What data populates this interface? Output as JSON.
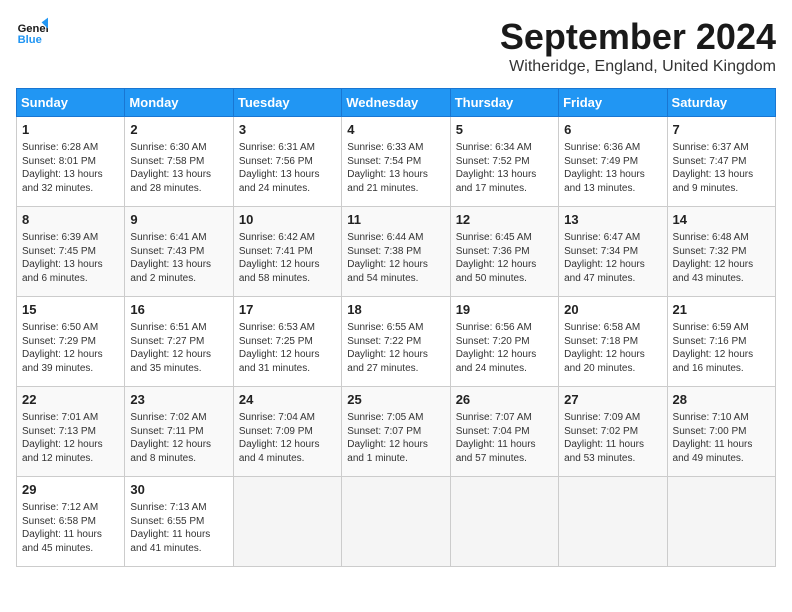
{
  "header": {
    "logo_line1": "General",
    "logo_line2": "Blue",
    "title": "September 2024",
    "subtitle": "Witheridge, England, United Kingdom"
  },
  "calendar": {
    "days_of_week": [
      "Sunday",
      "Monday",
      "Tuesday",
      "Wednesday",
      "Thursday",
      "Friday",
      "Saturday"
    ],
    "weeks": [
      [
        {
          "day": "",
          "empty": true
        },
        {
          "day": "",
          "empty": true
        },
        {
          "day": "",
          "empty": true
        },
        {
          "day": "",
          "empty": true
        },
        {
          "day": "",
          "empty": true
        },
        {
          "day": "",
          "empty": true
        },
        {
          "day": "",
          "empty": true
        }
      ],
      [
        {
          "day": "1",
          "info": "Sunrise: 6:28 AM\nSunset: 8:01 PM\nDaylight: 13 hours\nand 32 minutes."
        },
        {
          "day": "2",
          "info": "Sunrise: 6:30 AM\nSunset: 7:58 PM\nDaylight: 13 hours\nand 28 minutes."
        },
        {
          "day": "3",
          "info": "Sunrise: 6:31 AM\nSunset: 7:56 PM\nDaylight: 13 hours\nand 24 minutes."
        },
        {
          "day": "4",
          "info": "Sunrise: 6:33 AM\nSunset: 7:54 PM\nDaylight: 13 hours\nand 21 minutes."
        },
        {
          "day": "5",
          "info": "Sunrise: 6:34 AM\nSunset: 7:52 PM\nDaylight: 13 hours\nand 17 minutes."
        },
        {
          "day": "6",
          "info": "Sunrise: 6:36 AM\nSunset: 7:49 PM\nDaylight: 13 hours\nand 13 minutes."
        },
        {
          "day": "7",
          "info": "Sunrise: 6:37 AM\nSunset: 7:47 PM\nDaylight: 13 hours\nand 9 minutes."
        }
      ],
      [
        {
          "day": "8",
          "info": "Sunrise: 6:39 AM\nSunset: 7:45 PM\nDaylight: 13 hours\nand 6 minutes."
        },
        {
          "day": "9",
          "info": "Sunrise: 6:41 AM\nSunset: 7:43 PM\nDaylight: 13 hours\nand 2 minutes."
        },
        {
          "day": "10",
          "info": "Sunrise: 6:42 AM\nSunset: 7:41 PM\nDaylight: 12 hours\nand 58 minutes."
        },
        {
          "day": "11",
          "info": "Sunrise: 6:44 AM\nSunset: 7:38 PM\nDaylight: 12 hours\nand 54 minutes."
        },
        {
          "day": "12",
          "info": "Sunrise: 6:45 AM\nSunset: 7:36 PM\nDaylight: 12 hours\nand 50 minutes."
        },
        {
          "day": "13",
          "info": "Sunrise: 6:47 AM\nSunset: 7:34 PM\nDaylight: 12 hours\nand 47 minutes."
        },
        {
          "day": "14",
          "info": "Sunrise: 6:48 AM\nSunset: 7:32 PM\nDaylight: 12 hours\nand 43 minutes."
        }
      ],
      [
        {
          "day": "15",
          "info": "Sunrise: 6:50 AM\nSunset: 7:29 PM\nDaylight: 12 hours\nand 39 minutes."
        },
        {
          "day": "16",
          "info": "Sunrise: 6:51 AM\nSunset: 7:27 PM\nDaylight: 12 hours\nand 35 minutes."
        },
        {
          "day": "17",
          "info": "Sunrise: 6:53 AM\nSunset: 7:25 PM\nDaylight: 12 hours\nand 31 minutes."
        },
        {
          "day": "18",
          "info": "Sunrise: 6:55 AM\nSunset: 7:22 PM\nDaylight: 12 hours\nand 27 minutes."
        },
        {
          "day": "19",
          "info": "Sunrise: 6:56 AM\nSunset: 7:20 PM\nDaylight: 12 hours\nand 24 minutes."
        },
        {
          "day": "20",
          "info": "Sunrise: 6:58 AM\nSunset: 7:18 PM\nDaylight: 12 hours\nand 20 minutes."
        },
        {
          "day": "21",
          "info": "Sunrise: 6:59 AM\nSunset: 7:16 PM\nDaylight: 12 hours\nand 16 minutes."
        }
      ],
      [
        {
          "day": "22",
          "info": "Sunrise: 7:01 AM\nSunset: 7:13 PM\nDaylight: 12 hours\nand 12 minutes."
        },
        {
          "day": "23",
          "info": "Sunrise: 7:02 AM\nSunset: 7:11 PM\nDaylight: 12 hours\nand 8 minutes."
        },
        {
          "day": "24",
          "info": "Sunrise: 7:04 AM\nSunset: 7:09 PM\nDaylight: 12 hours\nand 4 minutes."
        },
        {
          "day": "25",
          "info": "Sunrise: 7:05 AM\nSunset: 7:07 PM\nDaylight: 12 hours\nand 1 minute."
        },
        {
          "day": "26",
          "info": "Sunrise: 7:07 AM\nSunset: 7:04 PM\nDaylight: 11 hours\nand 57 minutes."
        },
        {
          "day": "27",
          "info": "Sunrise: 7:09 AM\nSunset: 7:02 PM\nDaylight: 11 hours\nand 53 minutes."
        },
        {
          "day": "28",
          "info": "Sunrise: 7:10 AM\nSunset: 7:00 PM\nDaylight: 11 hours\nand 49 minutes."
        }
      ],
      [
        {
          "day": "29",
          "info": "Sunrise: 7:12 AM\nSunset: 6:58 PM\nDaylight: 11 hours\nand 45 minutes."
        },
        {
          "day": "30",
          "info": "Sunrise: 7:13 AM\nSunset: 6:55 PM\nDaylight: 11 hours\nand 41 minutes."
        },
        {
          "day": "",
          "empty": true
        },
        {
          "day": "",
          "empty": true
        },
        {
          "day": "",
          "empty": true
        },
        {
          "day": "",
          "empty": true
        },
        {
          "day": "",
          "empty": true
        }
      ]
    ]
  }
}
